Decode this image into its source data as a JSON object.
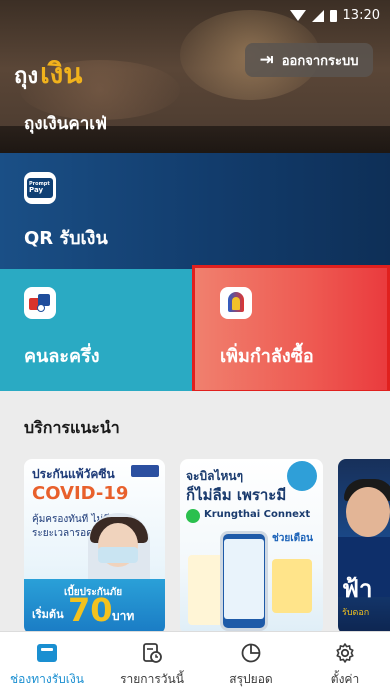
{
  "status_bar": {
    "time": "13:20"
  },
  "header": {
    "logo_prefix": "ถุง",
    "logo_highlight": "เงิน",
    "logout_label": "ออกจากระบบ",
    "cafe_name": "ถุงเงินคาเฟ่"
  },
  "tiles": {
    "qr": {
      "label": "QR รับเงิน",
      "icon_line1": "Prompt",
      "icon_line2": "Pay"
    },
    "half": {
      "label": "คนละครึ่ง"
    },
    "boost": {
      "label": "เพิ่มกำลังซื้อ"
    }
  },
  "section": {
    "title": "บริการแนะนำ",
    "cards": [
      {
        "line1": "ประกันแพ้วัคซีน",
        "line2": "COVID-19",
        "line3": "คุ้มครองทันที ไม่มีระยะเวลารอคอย",
        "premium": "เบี้ยประกันภัย",
        "start": "เริ่มต้น",
        "amount": "70",
        "unit": "บาท"
      },
      {
        "line1": "จะบิลไหนๆ",
        "line2": "ก็ไม่ลืม เพราะมี",
        "line3": "Krungthai Connext",
        "month": "ช่วยเตือน"
      },
      {
        "big": "ฟ้า",
        "sub": "รับดอก"
      }
    ]
  },
  "bottom_nav": {
    "items": [
      {
        "label": "ช่องทางรับเงิน",
        "active": true
      },
      {
        "label": "รายการวันนี้"
      },
      {
        "label": "สรุปยอด"
      },
      {
        "label": "ตั้งค่า"
      }
    ]
  },
  "colors": {
    "accent": "#1a8fd1",
    "logo_yellow": "#f1b21c",
    "qr_tile": "#123c6c",
    "half_tile": "#2aaac3",
    "boost_tile": "#ee5a52",
    "highlight_border": "#e0201e"
  }
}
